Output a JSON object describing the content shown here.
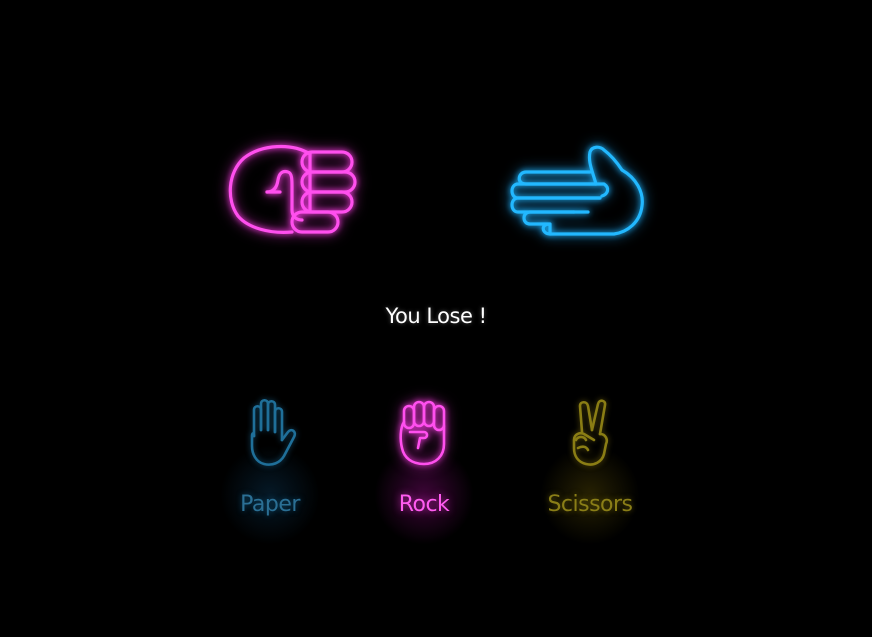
{
  "game": {
    "player_choice_icon": "rock-fist-icon",
    "computer_choice_icon": "paper-hand-icon",
    "result_text": "You Lose !"
  },
  "choices": [
    {
      "label": "Paper",
      "icon": "paper-hand-icon",
      "color": "#2b6f94"
    },
    {
      "label": "Rock",
      "icon": "rock-fist-icon",
      "color": "#ff5cf0"
    },
    {
      "label": "Scissors",
      "icon": "scissors-hand-icon",
      "color": "#8a7e17"
    }
  ],
  "colors": {
    "background": "#000000",
    "player_hand": "#ff3de8",
    "computer_hand": "#1fb6ff",
    "result_text": "#ffffff"
  }
}
